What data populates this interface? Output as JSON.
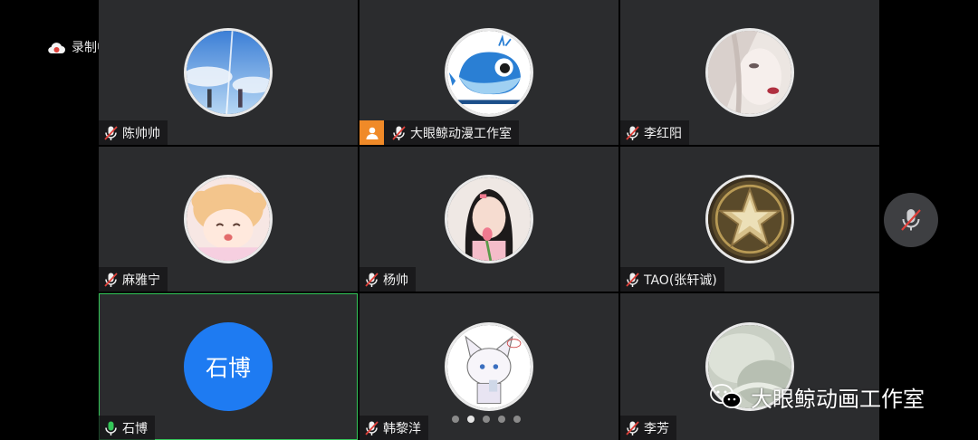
{
  "recording": {
    "label": "录制中"
  },
  "participants": [
    {
      "name": "陈帅帅"
    },
    {
      "name": "大眼鲸动漫工作室"
    },
    {
      "name": "李红阳"
    },
    {
      "name": "麻雅宁"
    },
    {
      "name": "杨帅"
    },
    {
      "name": "TAO(张轩诚)"
    },
    {
      "name": "石博",
      "avatar_text": "石博"
    },
    {
      "name": "韩黎洋"
    },
    {
      "name": "李芳"
    }
  ],
  "watermark": {
    "text": "大眼鲸动画工作室"
  },
  "colors": {
    "tile_bg": "#2b2c2e",
    "active_border": "#34c759",
    "host_badge": "#f08a28",
    "text_avatar": "#1e7bf2",
    "mic_muted": "#e0403a"
  },
  "icons": {
    "recording": "cloud-recording-icon",
    "mic": "mic-muted-icon",
    "host": "host-person-icon",
    "mute_button": "mic-off-icon",
    "watermark": "wechat-icon"
  }
}
